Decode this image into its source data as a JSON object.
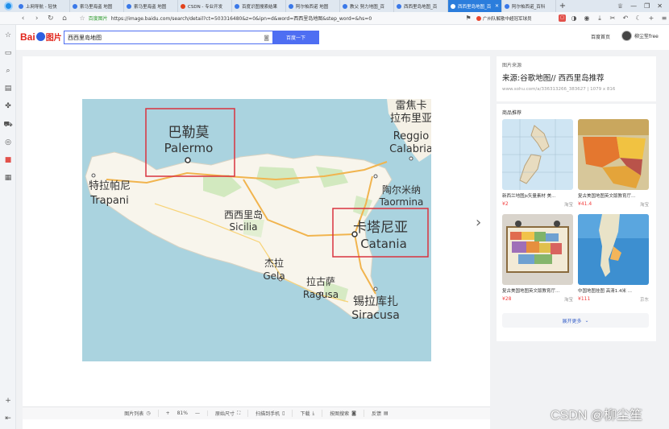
{
  "browser": {
    "tabs": [
      {
        "label": "上网导航 - 轻快",
        "active": false
      },
      {
        "label": "索马里海盗 地图",
        "active": false
      },
      {
        "label": "索马里海盗 地图",
        "active": false
      },
      {
        "label": "CSDN - 专业开发",
        "active": false
      },
      {
        "label": "百度识图搜索结果",
        "active": false
      },
      {
        "label": "阿尔帕西诺 地图",
        "active": false
      },
      {
        "label": "教父 努力地图_百",
        "active": false
      },
      {
        "label": "西西里岛地图_百",
        "active": false
      },
      {
        "label": "西西里岛地图_百",
        "active": true
      },
      {
        "label": "阿尔帕西诺_百科",
        "active": false
      }
    ],
    "address": {
      "site_label": "百度图片",
      "url": "https://image.baidu.com/search/detail?ct=503316480&z=0&ipn=d&word=西西里岛地图&step_word=&hs=0"
    },
    "promo_text": "广州队解散中超冠军球员"
  },
  "header": {
    "logo_text": "Bai",
    "logo_text2": "图片",
    "search_value": "西西里岛地图",
    "search_button": "百度一下",
    "home_link": "百度首页",
    "username": "柳尘笙free"
  },
  "map": {
    "labels": [
      {
        "zh": "巴勒莫",
        "en": "Palermo"
      },
      {
        "zh": "卡塔尼亚",
        "en": "Catania"
      },
      {
        "zh": "特拉帕尼",
        "en": "Trapani"
      },
      {
        "zh": "西西里岛",
        "en": "Sicilia"
      },
      {
        "zh": "杰拉",
        "en": "Gela"
      },
      {
        "zh": "拉古萨",
        "en": "Ragusa"
      },
      {
        "zh": "锡拉库扎",
        "en": "Siracusa"
      },
      {
        "zh": "陶尔米纳",
        "en": "Taormina"
      },
      {
        "zh": "雷焦卡拉布里亚",
        "en": "Reggio Calabria"
      }
    ]
  },
  "viewer_bar": {
    "list": "图片列表",
    "zoom_minus": "—",
    "zoom_plus": "+",
    "zoom_value": "81%",
    "original": "原始尺寸",
    "scan": "扫描到手机",
    "download": "下载",
    "similar": "按图搜索",
    "feedback": "反馈"
  },
  "info": {
    "label": "图片来源",
    "title": "来源:谷歌地图// 西西里岛推荐",
    "url": "www.sohu.com/a/336313266_383627",
    "size": "1079 x 816"
  },
  "recommend": {
    "label": "商品推荐",
    "items": [
      {
        "title": "新西兰地图js矢量素材 美...",
        "price": "¥2",
        "shop": "淘宝"
      },
      {
        "title": "复古美国地图英文版教育厅...",
        "price": "¥41.4",
        "shop": "淘宝"
      },
      {
        "title": "复古美国地图英文版教育厅...",
        "price": "¥28",
        "shop": "淘宝"
      },
      {
        "title": "中国地图挂图 高清1.4米 ...",
        "price": "¥111",
        "shop": "京东"
      }
    ],
    "more": "展开更多"
  },
  "watermark": "CSDN @柳尘笙"
}
